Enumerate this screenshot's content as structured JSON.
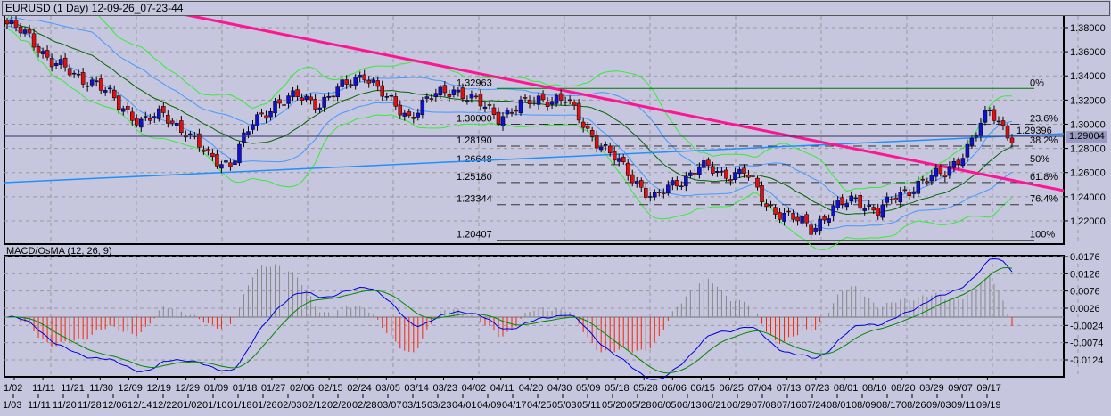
{
  "title": "EURUSD (1 Day) 12-09-26_07-23-44",
  "macd_label": "MACD/OsMA (12, 26, 9)",
  "current_price_label": "1.29004",
  "trendline_price_label": "1.29396",
  "colors": {
    "bg": "#c6c6de",
    "bull": "#1010d0",
    "bear": "#e01010",
    "bb_outer": "#33ee33",
    "bb_mid": "#006600",
    "bb_inner": "#4499ff",
    "trend_pink": "#ff1493",
    "trend_blue": "#1e90ff",
    "hist_pos": "#888888",
    "hist_neg": "#ff2200"
  },
  "chart_data": [
    {
      "type": "candlestick",
      "symbol": "EURUSD",
      "timeframe": "1 Day",
      "ylim": [
        1.195,
        1.39
      ],
      "yticks": [
        "1.38000",
        "1.36000",
        "1.34000",
        "1.32000",
        "1.30000",
        "1.28000",
        "1.26000",
        "1.24000",
        "1.22000"
      ],
      "ytick_values": [
        1.38,
        1.36,
        1.34,
        1.32,
        1.3,
        1.28,
        1.26,
        1.24,
        1.22
      ],
      "approx_closes": [
        1.383,
        1.372,
        1.352,
        1.34,
        1.335,
        1.315,
        1.303,
        1.307,
        1.295,
        1.272,
        1.268,
        1.3,
        1.318,
        1.322,
        1.318,
        1.33,
        1.343,
        1.32,
        1.307,
        1.322,
        1.33,
        1.318,
        1.307,
        1.315,
        1.322,
        1.32,
        1.295,
        1.275,
        1.256,
        1.238,
        1.252,
        1.265,
        1.258,
        1.262,
        1.232,
        1.225,
        1.212,
        1.232,
        1.236,
        1.23,
        1.24,
        1.255,
        1.258,
        1.282,
        1.31,
        1.29
      ],
      "current_price": 1.29004,
      "fibonacci": [
        {
          "pct": "0%",
          "price": "1.32963",
          "v": 1.32963
        },
        {
          "pct": "23.6%",
          "price": "1.30000",
          "v": 1.3
        },
        {
          "pct": "38.2%",
          "price": "1.28190",
          "v": 1.2819
        },
        {
          "pct": "50%",
          "price": "1.26648",
          "v": 1.26648
        },
        {
          "pct": "61.8%",
          "price": "1.25180",
          "v": 1.2518
        },
        {
          "pct": "76.4%",
          "price": "1.23344",
          "v": 1.23344
        },
        {
          "pct": "100%",
          "price": "1.20407",
          "v": 1.20407
        }
      ],
      "x_labels_top": [
        "1/02",
        "11/11",
        "11/21",
        "11/30",
        "12/09",
        "12/19",
        "12/29",
        "01/09",
        "01/18",
        "01/27",
        "02/06",
        "02/15",
        "02/24",
        "03/05",
        "03/14",
        "03/23",
        "04/02",
        "04/11",
        "04/20",
        "04/30",
        "05/09",
        "05/18",
        "05/28",
        "06/06",
        "06/15",
        "06/25",
        "07/04",
        "07/13",
        "07/23",
        "08/01",
        "08/10",
        "08/20",
        "08/29",
        "09/07",
        "09/17"
      ],
      "x_labels_bottom": [
        "1/03",
        "11/11",
        "11/20",
        "11/28",
        "12/06",
        "12/14",
        "12/22",
        "01/02",
        "01/10",
        "01/18",
        "01/26",
        "02/03",
        "02/12",
        "02/20",
        "02/28",
        "03/07",
        "03/15",
        "03/23",
        "04/01",
        "04/09",
        "04/17",
        "04/25",
        "05/03",
        "05/11",
        "05/20",
        "05/28",
        "06/05",
        "06/13",
        "06/21",
        "06/29",
        "07/08",
        "07/16",
        "07/24",
        "08/01",
        "08/09",
        "08/17",
        "08/26",
        "09/03",
        "09/11",
        "09/19"
      ]
    },
    {
      "type": "line",
      "name": "MACD/OsMA",
      "params": [
        12,
        26,
        9
      ],
      "ylim": [
        -0.0145,
        0.0176
      ],
      "yticks": [
        "0.0176",
        "0.0126",
        "0.0076",
        "0.0026",
        "-0.0024",
        "-0.0074",
        "-0.0124"
      ],
      "ytick_values": [
        0.0176,
        0.0126,
        0.0076,
        0.0026,
        -0.0024,
        -0.0074,
        -0.0124
      ]
    }
  ]
}
